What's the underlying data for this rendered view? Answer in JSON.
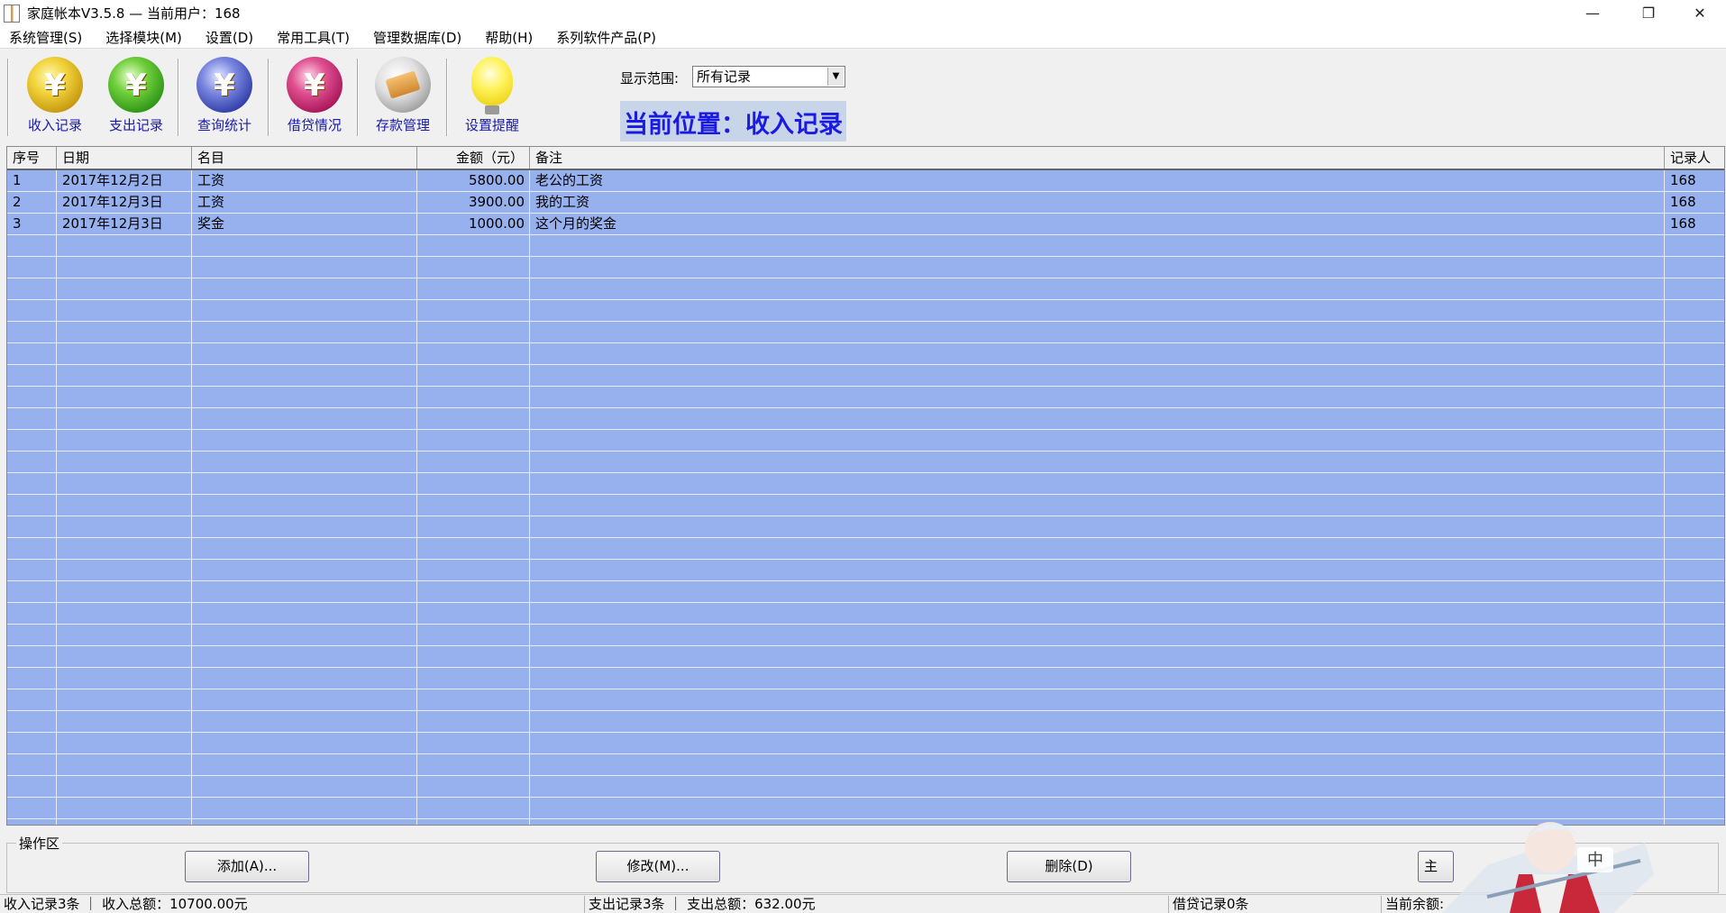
{
  "window": {
    "title": "家庭帐本V3.5.8 — 当前用户：168",
    "minimize_glyph": "—",
    "restore_glyph": "❐",
    "close_glyph": "✕"
  },
  "menu": [
    "系统管理(S)",
    "选择模块(M)",
    "设置(D)",
    "常用工具(T)",
    "管理数据库(D)",
    "帮助(H)",
    "系列软件产品(P)"
  ],
  "toolbar": {
    "buttons": [
      {
        "label": "收入记录",
        "icon": "yen-coin-icon"
      },
      {
        "label": "支出记录",
        "icon": "yen-coin-green-icon"
      },
      {
        "label": "查询统计",
        "icon": "magnifier-coin-icon"
      },
      {
        "label": "借贷情况",
        "icon": "exchange-coin-icon"
      },
      {
        "label": "存款管理",
        "icon": "bank-card-icon"
      },
      {
        "label": "设置提醒",
        "icon": "light-bulb-icon"
      }
    ],
    "range_label": "显示范围:",
    "range_value": "所有记录",
    "location": "当前位置：收入记录"
  },
  "table": {
    "columns": [
      "序号",
      "日期",
      "名目",
      "金额（元）",
      "备注",
      "记录人"
    ],
    "rows": [
      [
        "1",
        "2017年12月2日",
        "工资",
        "5800.00",
        "老公的工资",
        "168"
      ],
      [
        "2",
        "2017年12月3日",
        "工资",
        "3900.00",
        "我的工资",
        "168"
      ],
      [
        "3",
        "2017年12月3日",
        "奖金",
        "1000.00",
        "这个月的奖金",
        "168"
      ]
    ]
  },
  "operations": {
    "group_label": "操作区",
    "add": "添加(A)...",
    "edit": "修改(M)...",
    "delete": "删除(D)",
    "partial": "主"
  },
  "status": {
    "income": "收入记录3条 ｜ 收入总额：10700.00元",
    "expense": "支出记录3条 ｜ 支出总额：632.00元",
    "loan": "借贷记录0条",
    "balance": "当前余额:"
  },
  "avatar": {
    "badge": "中"
  }
}
